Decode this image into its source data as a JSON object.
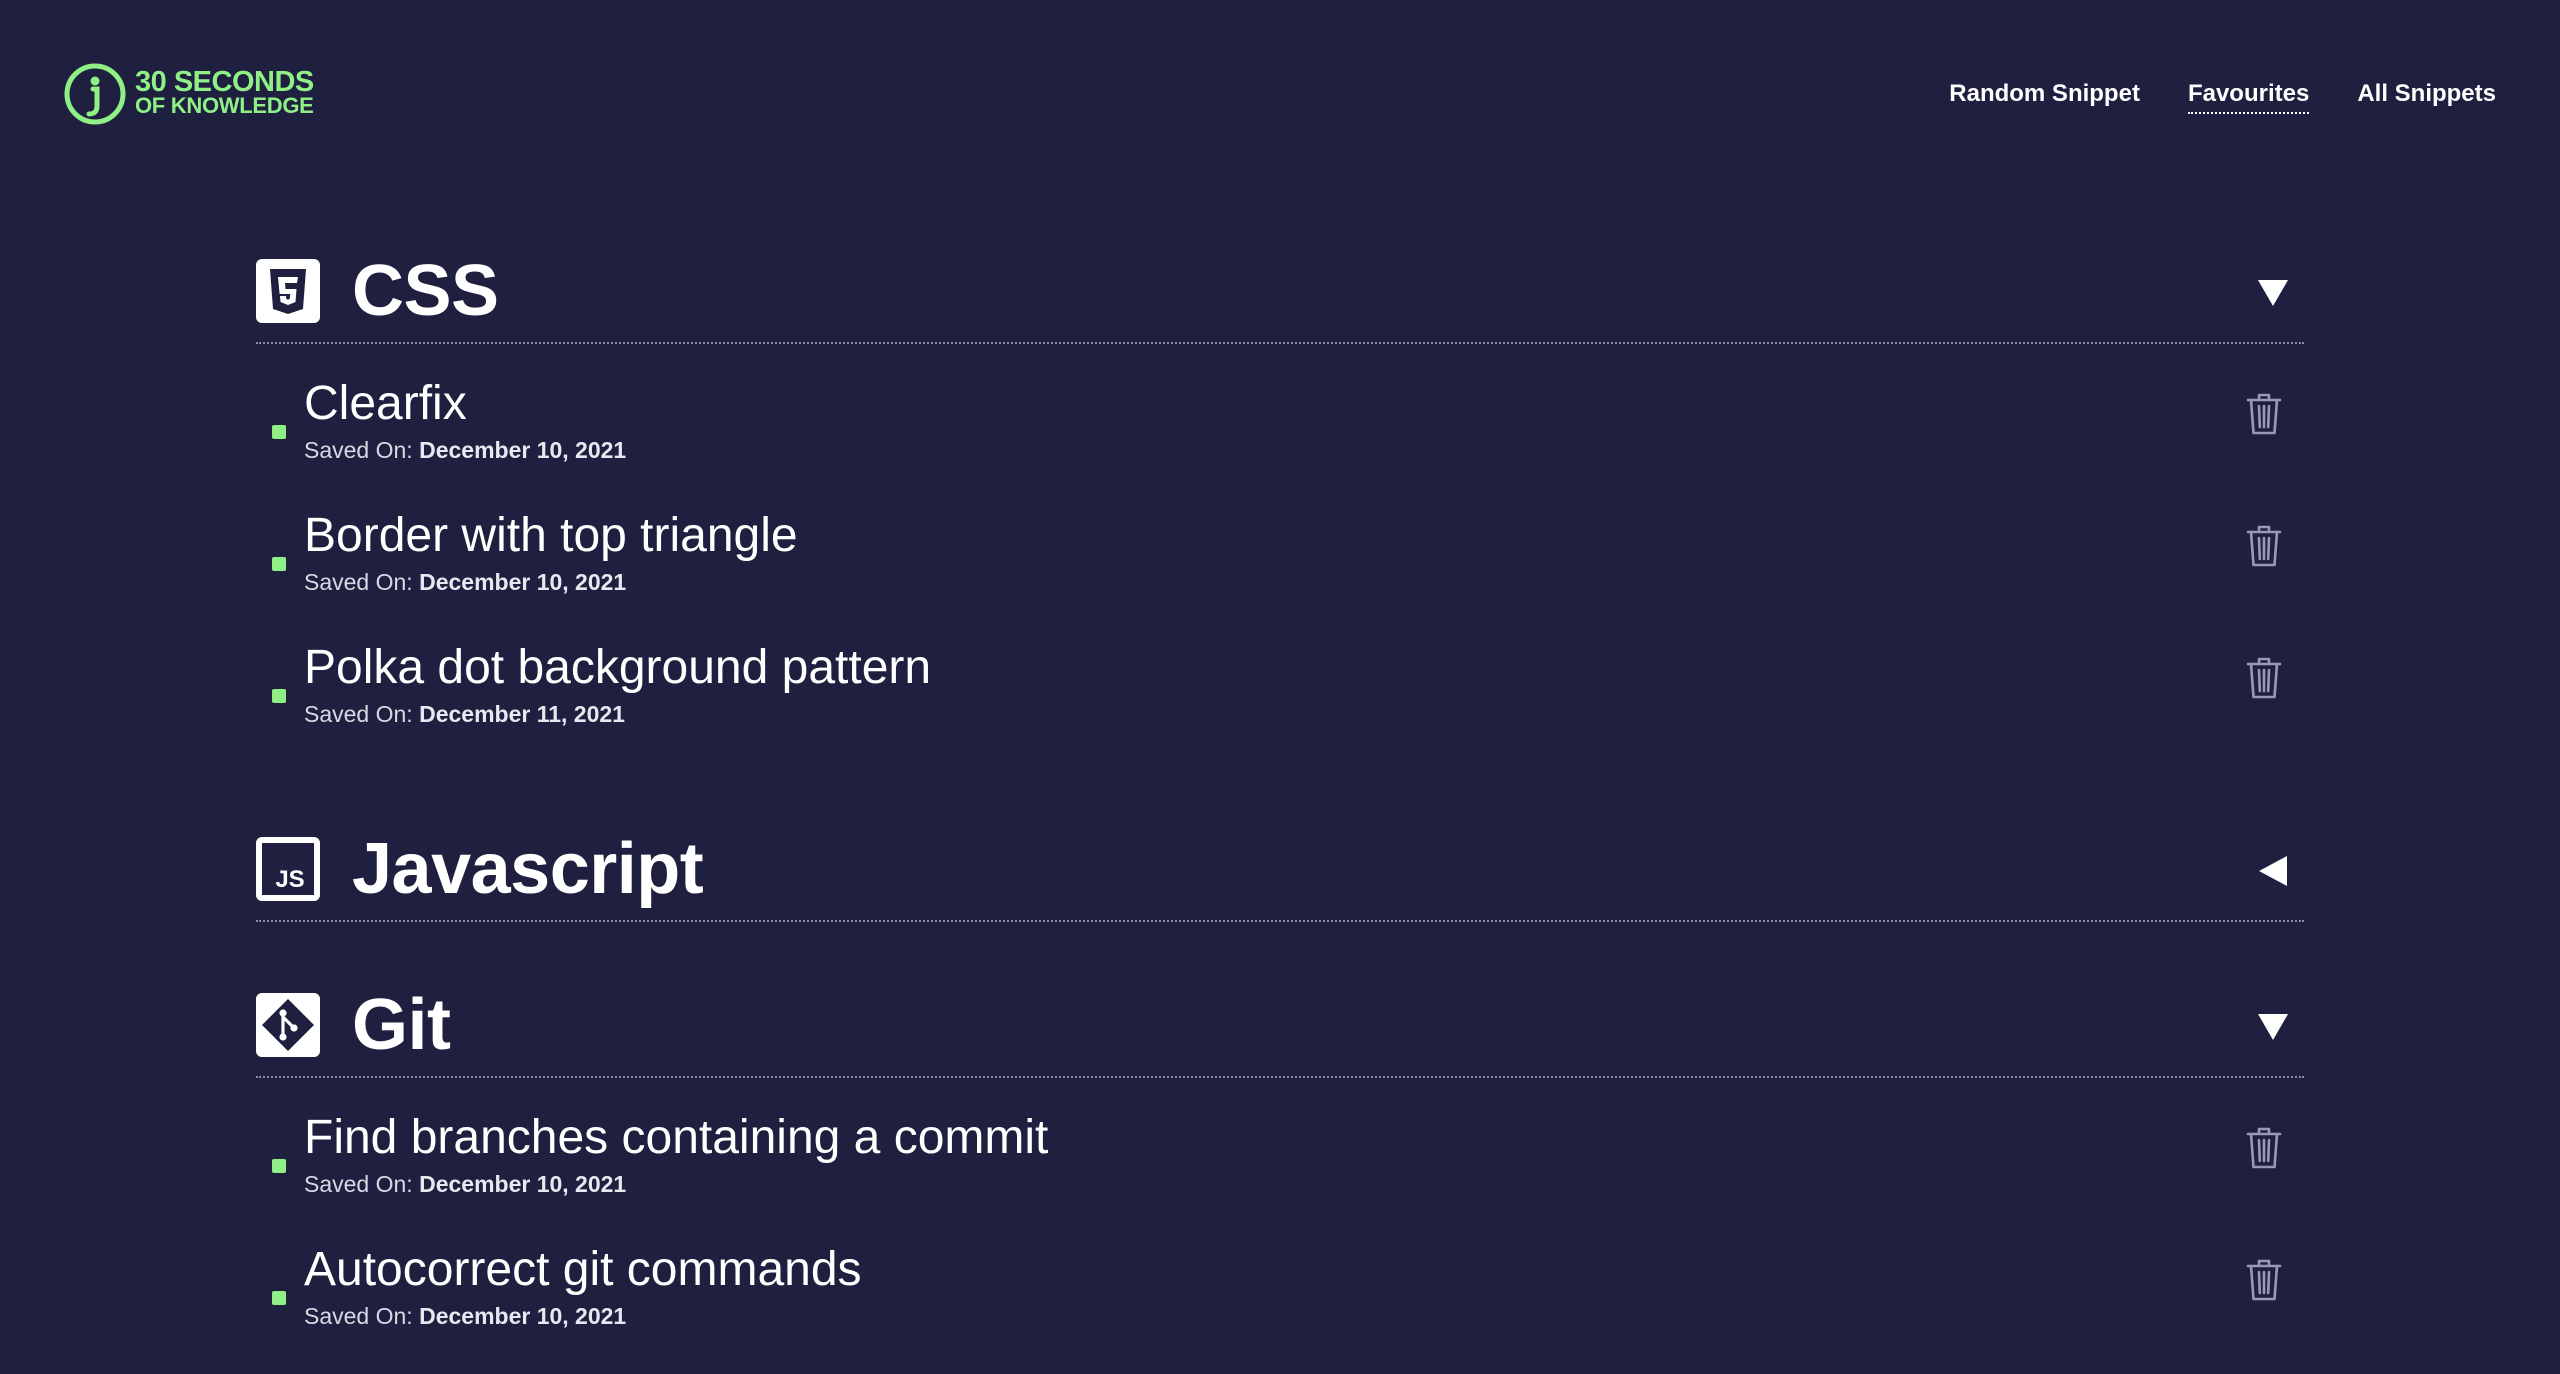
{
  "logo": {
    "line1": "30 SECONDS",
    "line2": "OF KNOWLEDGE"
  },
  "nav": {
    "items": [
      {
        "label": "Random Snippet",
        "active": false
      },
      {
        "label": "Favourites",
        "active": true
      },
      {
        "label": "All Snippets",
        "active": false
      }
    ]
  },
  "saved_prefix": "Saved On: ",
  "sections": [
    {
      "title": "CSS",
      "icon": "css3-icon",
      "expanded": true,
      "toggle_icon": "triangle-down-icon",
      "items": [
        {
          "title": "Clearfix",
          "date": "December 10, 2021"
        },
        {
          "title": "Border with top triangle",
          "date": "December 10, 2021"
        },
        {
          "title": "Polka dot background pattern",
          "date": "December 11, 2021"
        }
      ]
    },
    {
      "title": "Javascript",
      "icon": "javascript-icon",
      "expanded": false,
      "toggle_icon": "triangle-left-icon",
      "items": []
    },
    {
      "title": "Git",
      "icon": "git-icon",
      "expanded": true,
      "toggle_icon": "triangle-down-icon",
      "items": [
        {
          "title": "Find branches containing a commit",
          "date": "December 10, 2021"
        },
        {
          "title": "Autocorrect git commands",
          "date": "December 10, 2021"
        }
      ]
    }
  ],
  "colors": {
    "background": "#1f1f3f",
    "accent": "#8ff086",
    "text": "#ffffff",
    "icon_muted": "#9a9ab4"
  }
}
